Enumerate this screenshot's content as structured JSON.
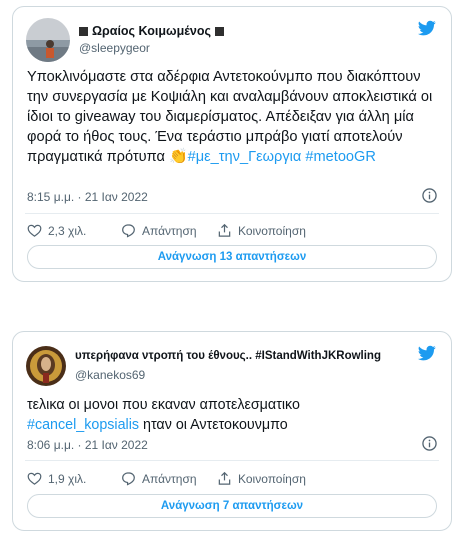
{
  "tweets": [
    {
      "display_name": "Ωραίος Κοιμωμένος",
      "handle": "@sleepygeor",
      "text_1": "Υποκλινόμαστε στα αδέρφια  Αντετοκούνμπο που διακόπτουν την συνεργασία με Κοψιάλη και αναλαμβάνουν αποκλειστικά οι ίδιοι το giveaway του διαμερίσματος. Απέδειξαν για άλλη μία φορά το ήθος τους. Ένα τεράστιο μπράβο γιατί αποτελούν πραγματικά πρότυπα ",
      "emoji": "👏",
      "hashtag_1": "#με_την_Γεωργια",
      "hashtag_2": "#metooGR",
      "timestamp": "8:15 μ.μ. · 21 Ιαν 2022",
      "likes": "2,3 χιλ.",
      "reply_label": "Απάντηση",
      "share_label": "Κοινοποίηση",
      "read_replies": "Ανάγνωση 13 απαντήσεων"
    },
    {
      "display_name": "υπερήφανα ντροπή του έθνους.. #IStandWithJKRowling",
      "handle": "@kanekos69",
      "text_1": "τελικα οι μονοι που εκαναν αποτελεσματικο",
      "hashtag_1": "#cancel_kopsialis",
      "text_2": " ηταν οι Αντετοκουνμπο",
      "timestamp": "8:06 μ.μ. · 21 Ιαν 2022",
      "likes": "1,9 χιλ.",
      "reply_label": "Απάντηση",
      "share_label": "Κοινοποίηση",
      "read_replies": "Ανάγνωση 7 απαντήσεων"
    }
  ],
  "colors": {
    "accent": "#1d9bf0",
    "secondary_text": "#536471",
    "border": "#cfd9de"
  },
  "icons": [
    "twitter-bird-icon",
    "info-icon",
    "heart-icon",
    "reply-icon",
    "share-icon"
  ]
}
